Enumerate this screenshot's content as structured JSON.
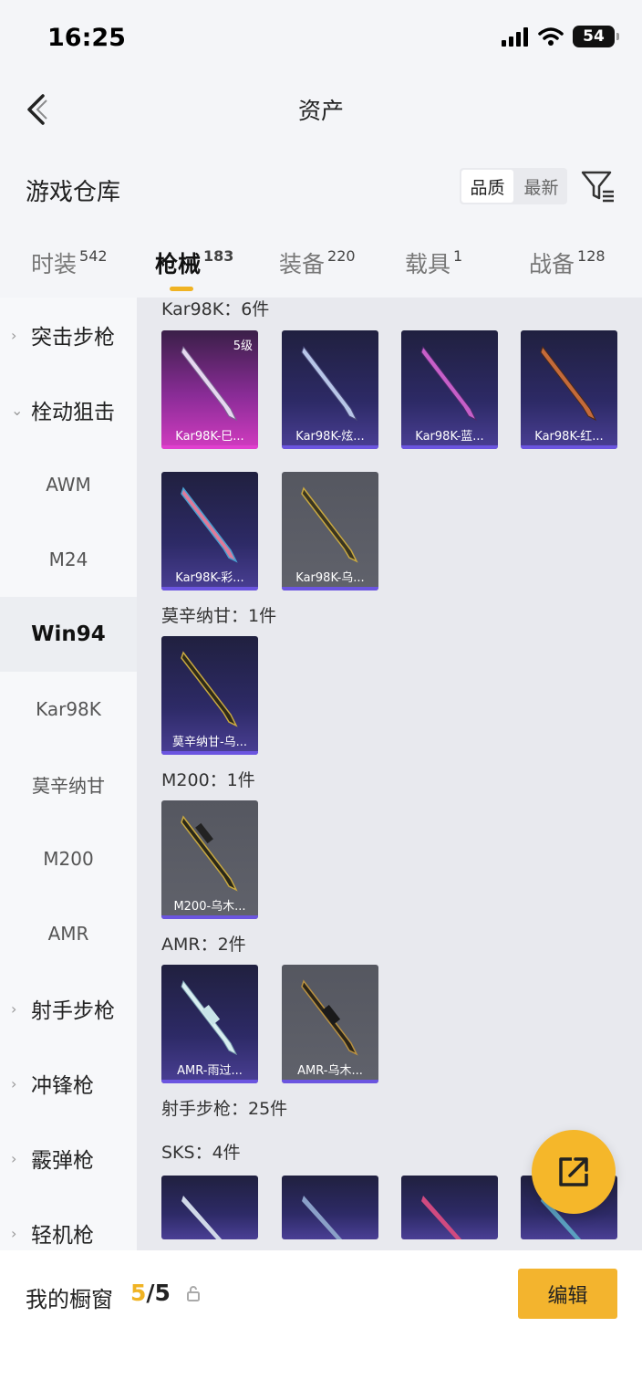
{
  "status": {
    "time": "16:25",
    "battery": "54"
  },
  "nav": {
    "title": "资产"
  },
  "section": {
    "title": "游戏仓库",
    "sort_quality": "品质",
    "sort_latest": "最新"
  },
  "tabs": [
    {
      "label": "时装",
      "count": "542"
    },
    {
      "label": "枪械",
      "count": "183"
    },
    {
      "label": "装备",
      "count": "220"
    },
    {
      "label": "载具",
      "count": "1"
    },
    {
      "label": "战备",
      "count": "128"
    }
  ],
  "sidebar": {
    "items": [
      {
        "label": "突击步枪"
      },
      {
        "label": "栓动狙击"
      },
      {
        "label": "AWM"
      },
      {
        "label": "M24"
      },
      {
        "label": "Win94"
      },
      {
        "label": "Kar98K"
      },
      {
        "label": "莫辛纳甘"
      },
      {
        "label": "M200"
      },
      {
        "label": "AMR"
      },
      {
        "label": "射手步枪"
      },
      {
        "label": "冲锋枪"
      },
      {
        "label": "霰弹枪"
      },
      {
        "label": "轻机枪"
      }
    ]
  },
  "groups": {
    "kar98k": "Kar98K：6件",
    "mosin": "莫辛纳甘：1件",
    "m200": "M200：1件",
    "amr": "AMR：2件",
    "dmr": "射手步枪：25件",
    "sks": "SKS：4件"
  },
  "cards": {
    "k1": {
      "name": "Kar98K-巳...",
      "level": "5级"
    },
    "k2": {
      "name": "Kar98K-炫..."
    },
    "k3": {
      "name": "Kar98K-蓝..."
    },
    "k4": {
      "name": "Kar98K-红..."
    },
    "k5": {
      "name": "Kar98K-彩..."
    },
    "k6": {
      "name": "Kar98K-乌..."
    },
    "m1": {
      "name": "莫辛纳甘-乌..."
    },
    "m200": {
      "name": "M200-乌木..."
    },
    "a1": {
      "name": "AMR-雨过..."
    },
    "a2": {
      "name": "AMR-乌木..."
    }
  },
  "bottom": {
    "showcase_label": "我的橱窗",
    "count_current": "5",
    "count_total": "/5",
    "edit_label": "编辑"
  },
  "colors": {
    "accent": "#f0b323",
    "card_purple": "#2d2a66",
    "card_magenta": "#d23cc0",
    "card_gray": "#5a5c65"
  }
}
